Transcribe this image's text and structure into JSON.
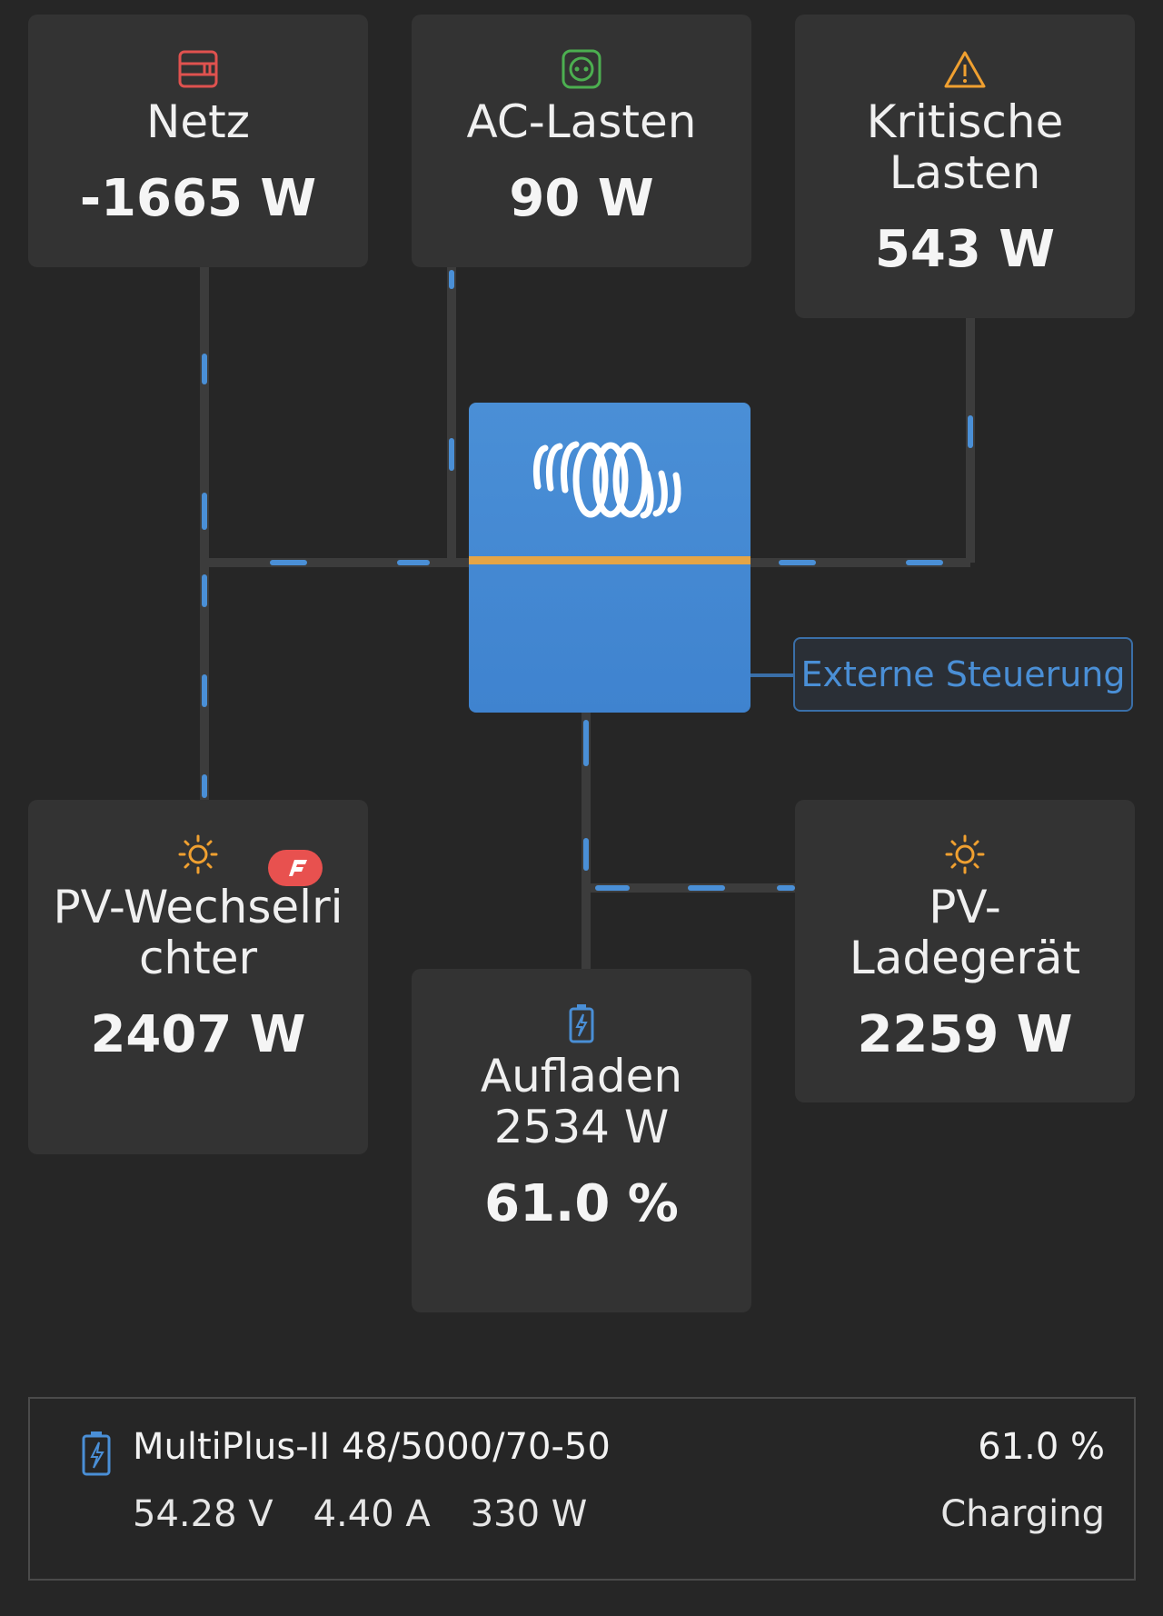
{
  "tiles": {
    "grid": {
      "title": "Netz",
      "value": "-1665 W",
      "icon": "grid-icon",
      "icon_color": "#e0524f"
    },
    "ac_loads": {
      "title": "AC-Lasten",
      "value": "90 W",
      "icon": "socket-icon",
      "icon_color": "#4caf50"
    },
    "critical_loads": {
      "title": "Kritische Lasten",
      "value": "543 W",
      "icon": "warning-icon",
      "icon_color": "#f0a030"
    },
    "pv_inverter": {
      "title": "PV-Wechselrichter",
      "value": "2407 W",
      "icon": "sun-icon",
      "icon_color": "#f0a030",
      "badge_icon": "fronius-badge-icon"
    },
    "pv_charger": {
      "title": "PV-Ladegerät",
      "value": "2259 W",
      "icon": "sun-icon",
      "icon_color": "#f0a030"
    },
    "battery": {
      "title": "Aufladen",
      "power": "2534 W",
      "soc": "61.0 %",
      "icon": "battery-charging-icon",
      "icon_color": "#4a8fd6"
    }
  },
  "inverter": {
    "logo": "victron-logo",
    "accent": "#4a8fd6",
    "stripe": "#e5a546"
  },
  "external_control": {
    "label": "Externe Steuerung"
  },
  "summary": {
    "device": "MultiPlus-II 48/5000/70-50",
    "soc": "61.0 %",
    "voltage": "54.28 V",
    "current": "4.40 A",
    "power": "330 W",
    "state": "Charging"
  },
  "colors": {
    "background": "#262626",
    "tile": "#333333",
    "wire": "#3c3c3c",
    "flow": "#4a8fd6"
  }
}
